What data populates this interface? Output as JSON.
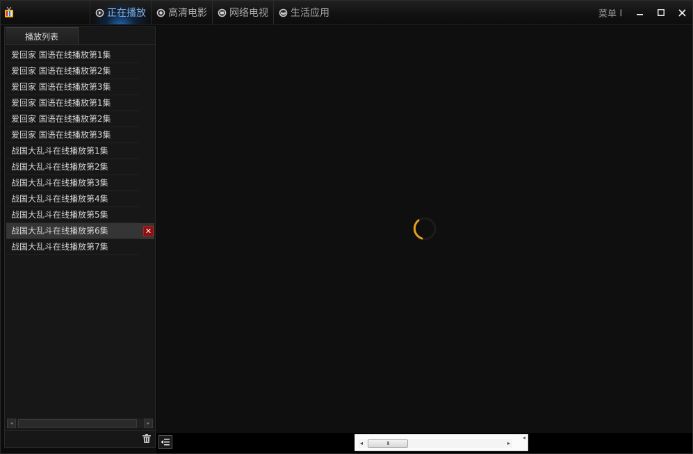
{
  "nav": {
    "tabs": [
      {
        "label": "正在播放",
        "icon": "play-circle-icon"
      },
      {
        "label": "高清电影",
        "icon": "film-circle-icon"
      },
      {
        "label": "网络电视",
        "icon": "tv-circle-icon"
      },
      {
        "label": "生活应用",
        "icon": "globe-circle-icon"
      }
    ],
    "active_index": 0
  },
  "window": {
    "menu_label": "菜单",
    "menu_suffix": "‖",
    "minimize_icon": "minimize-icon",
    "maximize_icon": "maximize-icon",
    "close_icon": "close-icon"
  },
  "sidebar": {
    "tab_label": "播放列表",
    "items": [
      {
        "title": "爱回家 国语在线播放第1集"
      },
      {
        "title": "爱回家 国语在线播放第2集"
      },
      {
        "title": "爱回家 国语在线播放第3集"
      },
      {
        "title": "爱回家 国语在线播放第1集"
      },
      {
        "title": "爱回家 国语在线播放第2集"
      },
      {
        "title": "爱回家 国语在线播放第3集"
      },
      {
        "title": "战国大乱斗在线播放第1集"
      },
      {
        "title": "战国大乱斗在线播放第2集"
      },
      {
        "title": "战国大乱斗在线播放第3集"
      },
      {
        "title": "战国大乱斗在线播放第4集"
      },
      {
        "title": "战国大乱斗在线播放第5集"
      },
      {
        "title": "战国大乱斗在线播放第6集"
      },
      {
        "title": "战国大乱斗在线播放第7集"
      }
    ],
    "selected_index": 11,
    "delete_glyph": "✕"
  },
  "scroll": {
    "left_arrow": "◂",
    "right_arrow": "▸",
    "thumb_grip": "III",
    "corner_glyph": "◂"
  },
  "colors": {
    "accent": "#4a9fef",
    "spinner": "#e8a01a",
    "delete": "#8c1010"
  }
}
